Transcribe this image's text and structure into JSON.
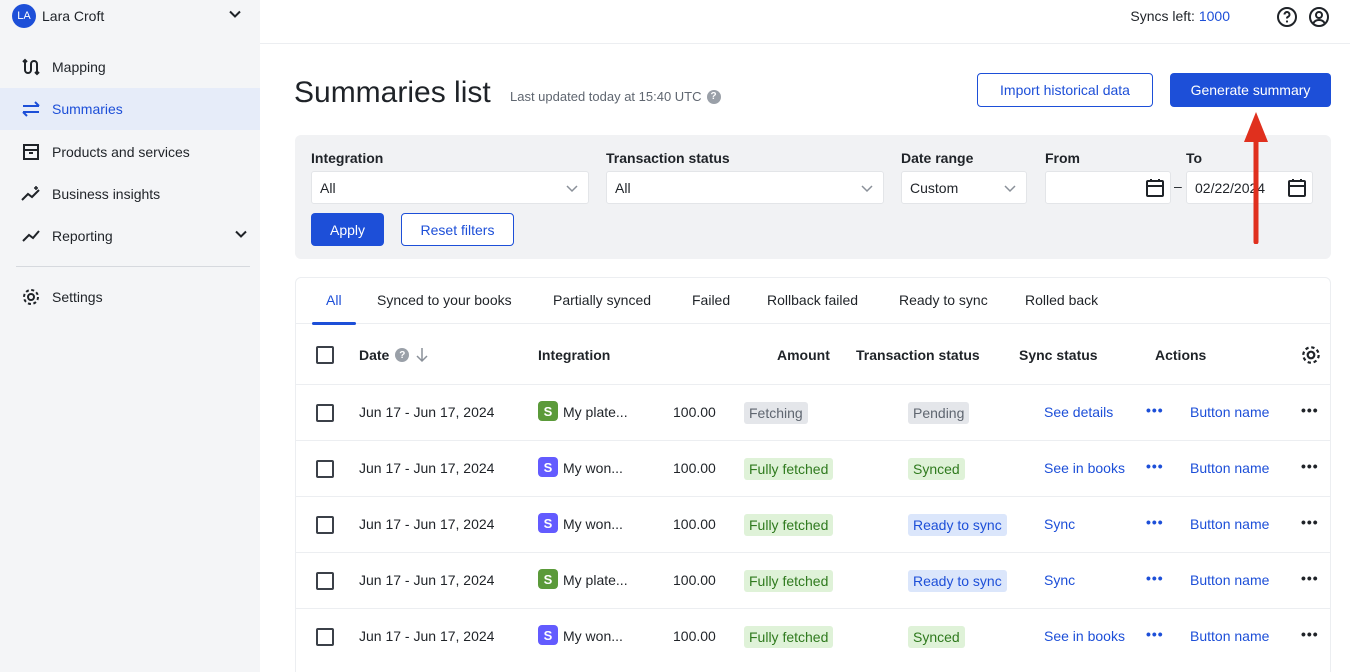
{
  "user": {
    "initials": "LA",
    "name": "Lara Croft"
  },
  "sidebar": {
    "items": [
      {
        "label": "Mapping",
        "icon": "mapping-icon"
      },
      {
        "label": "Summaries",
        "icon": "arrows-swap-icon",
        "active": true
      },
      {
        "label": "Products and services",
        "icon": "archive-box-icon"
      },
      {
        "label": "Business insights",
        "icon": "sparkle-chart-icon"
      },
      {
        "label": "Reporting",
        "icon": "trend-line-icon",
        "expandable": true
      },
      {
        "label": "Settings",
        "icon": "gear-icon"
      }
    ]
  },
  "topbar": {
    "syncs_label": "Syncs left:",
    "syncs_count": "1000"
  },
  "header": {
    "title": "Summaries list",
    "last_updated": "Last updated today at 15:40 UTC",
    "import_label": "Import historical data",
    "generate_label": "Generate summary"
  },
  "filters": {
    "integration_label": "Integration",
    "integration_value": "All",
    "status_label": "Transaction status",
    "status_value": "All",
    "date_range_label": "Date range",
    "date_range_value": "Custom",
    "from_label": "From",
    "from_value": "",
    "to_label": "To",
    "to_value": "02/22/2024",
    "dash": "–",
    "apply_label": "Apply",
    "reset_label": "Reset filters"
  },
  "tabs": [
    "All",
    "Synced to your books",
    "Partially synced",
    "Failed",
    "Rollback failed",
    "Ready to sync",
    "Rolled back"
  ],
  "table": {
    "headers": {
      "date": "Date",
      "integration": "Integration",
      "amount": "Amount",
      "transaction_status": "Transaction status",
      "sync_status": "Sync status",
      "actions": "Actions"
    },
    "rows": [
      {
        "date": "Jun 17 - Jun 17, 2024",
        "logo": "S",
        "logo_kind": "shop",
        "integration": "My plate...",
        "amount": "100.00",
        "fetch": "Fetching",
        "fetch_kind": "gray",
        "status": "Pending",
        "status_kind": "gray",
        "sync": "See details",
        "action": "Button name"
      },
      {
        "date": "Jun 17 - Jun 17, 2024",
        "logo": "S",
        "logo_kind": "stripe",
        "integration": "My won...",
        "amount": "100.00",
        "fetch": "Fully fetched",
        "fetch_kind": "green",
        "status": "Synced",
        "status_kind": "green",
        "sync": "See in books",
        "action": "Button name"
      },
      {
        "date": "Jun 17 - Jun 17, 2024",
        "logo": "S",
        "logo_kind": "stripe",
        "integration": "My won...",
        "amount": "100.00",
        "fetch": "Fully fetched",
        "fetch_kind": "green",
        "status": "Ready to sync",
        "status_kind": "blue",
        "sync": "Sync",
        "action": "Button name"
      },
      {
        "date": "Jun 17 - Jun 17, 2024",
        "logo": "S",
        "logo_kind": "shop",
        "integration": "My plate...",
        "amount": "100.00",
        "fetch": "Fully fetched",
        "fetch_kind": "green",
        "status": "Ready to sync",
        "status_kind": "blue",
        "sync": "Sync",
        "action": "Button name"
      },
      {
        "date": "Jun 17 - Jun 17, 2024",
        "logo": "S",
        "logo_kind": "stripe",
        "integration": "My won...",
        "amount": "100.00",
        "fetch": "Fully fetched",
        "fetch_kind": "green",
        "status": "Synced",
        "status_kind": "green",
        "sync": "See in books",
        "action": "Button name"
      }
    ]
  },
  "colors": {
    "accent": "#1d4fd8",
    "badge_gray_bg": "#e4e6ea",
    "badge_gray_fg": "#5f6670",
    "badge_green_bg": "#dff2d8",
    "badge_green_fg": "#2f7a1e",
    "badge_blue_bg": "#dbe6fb",
    "badge_blue_fg": "#1d4fd8",
    "annotation_arrow": "#e0301e"
  }
}
